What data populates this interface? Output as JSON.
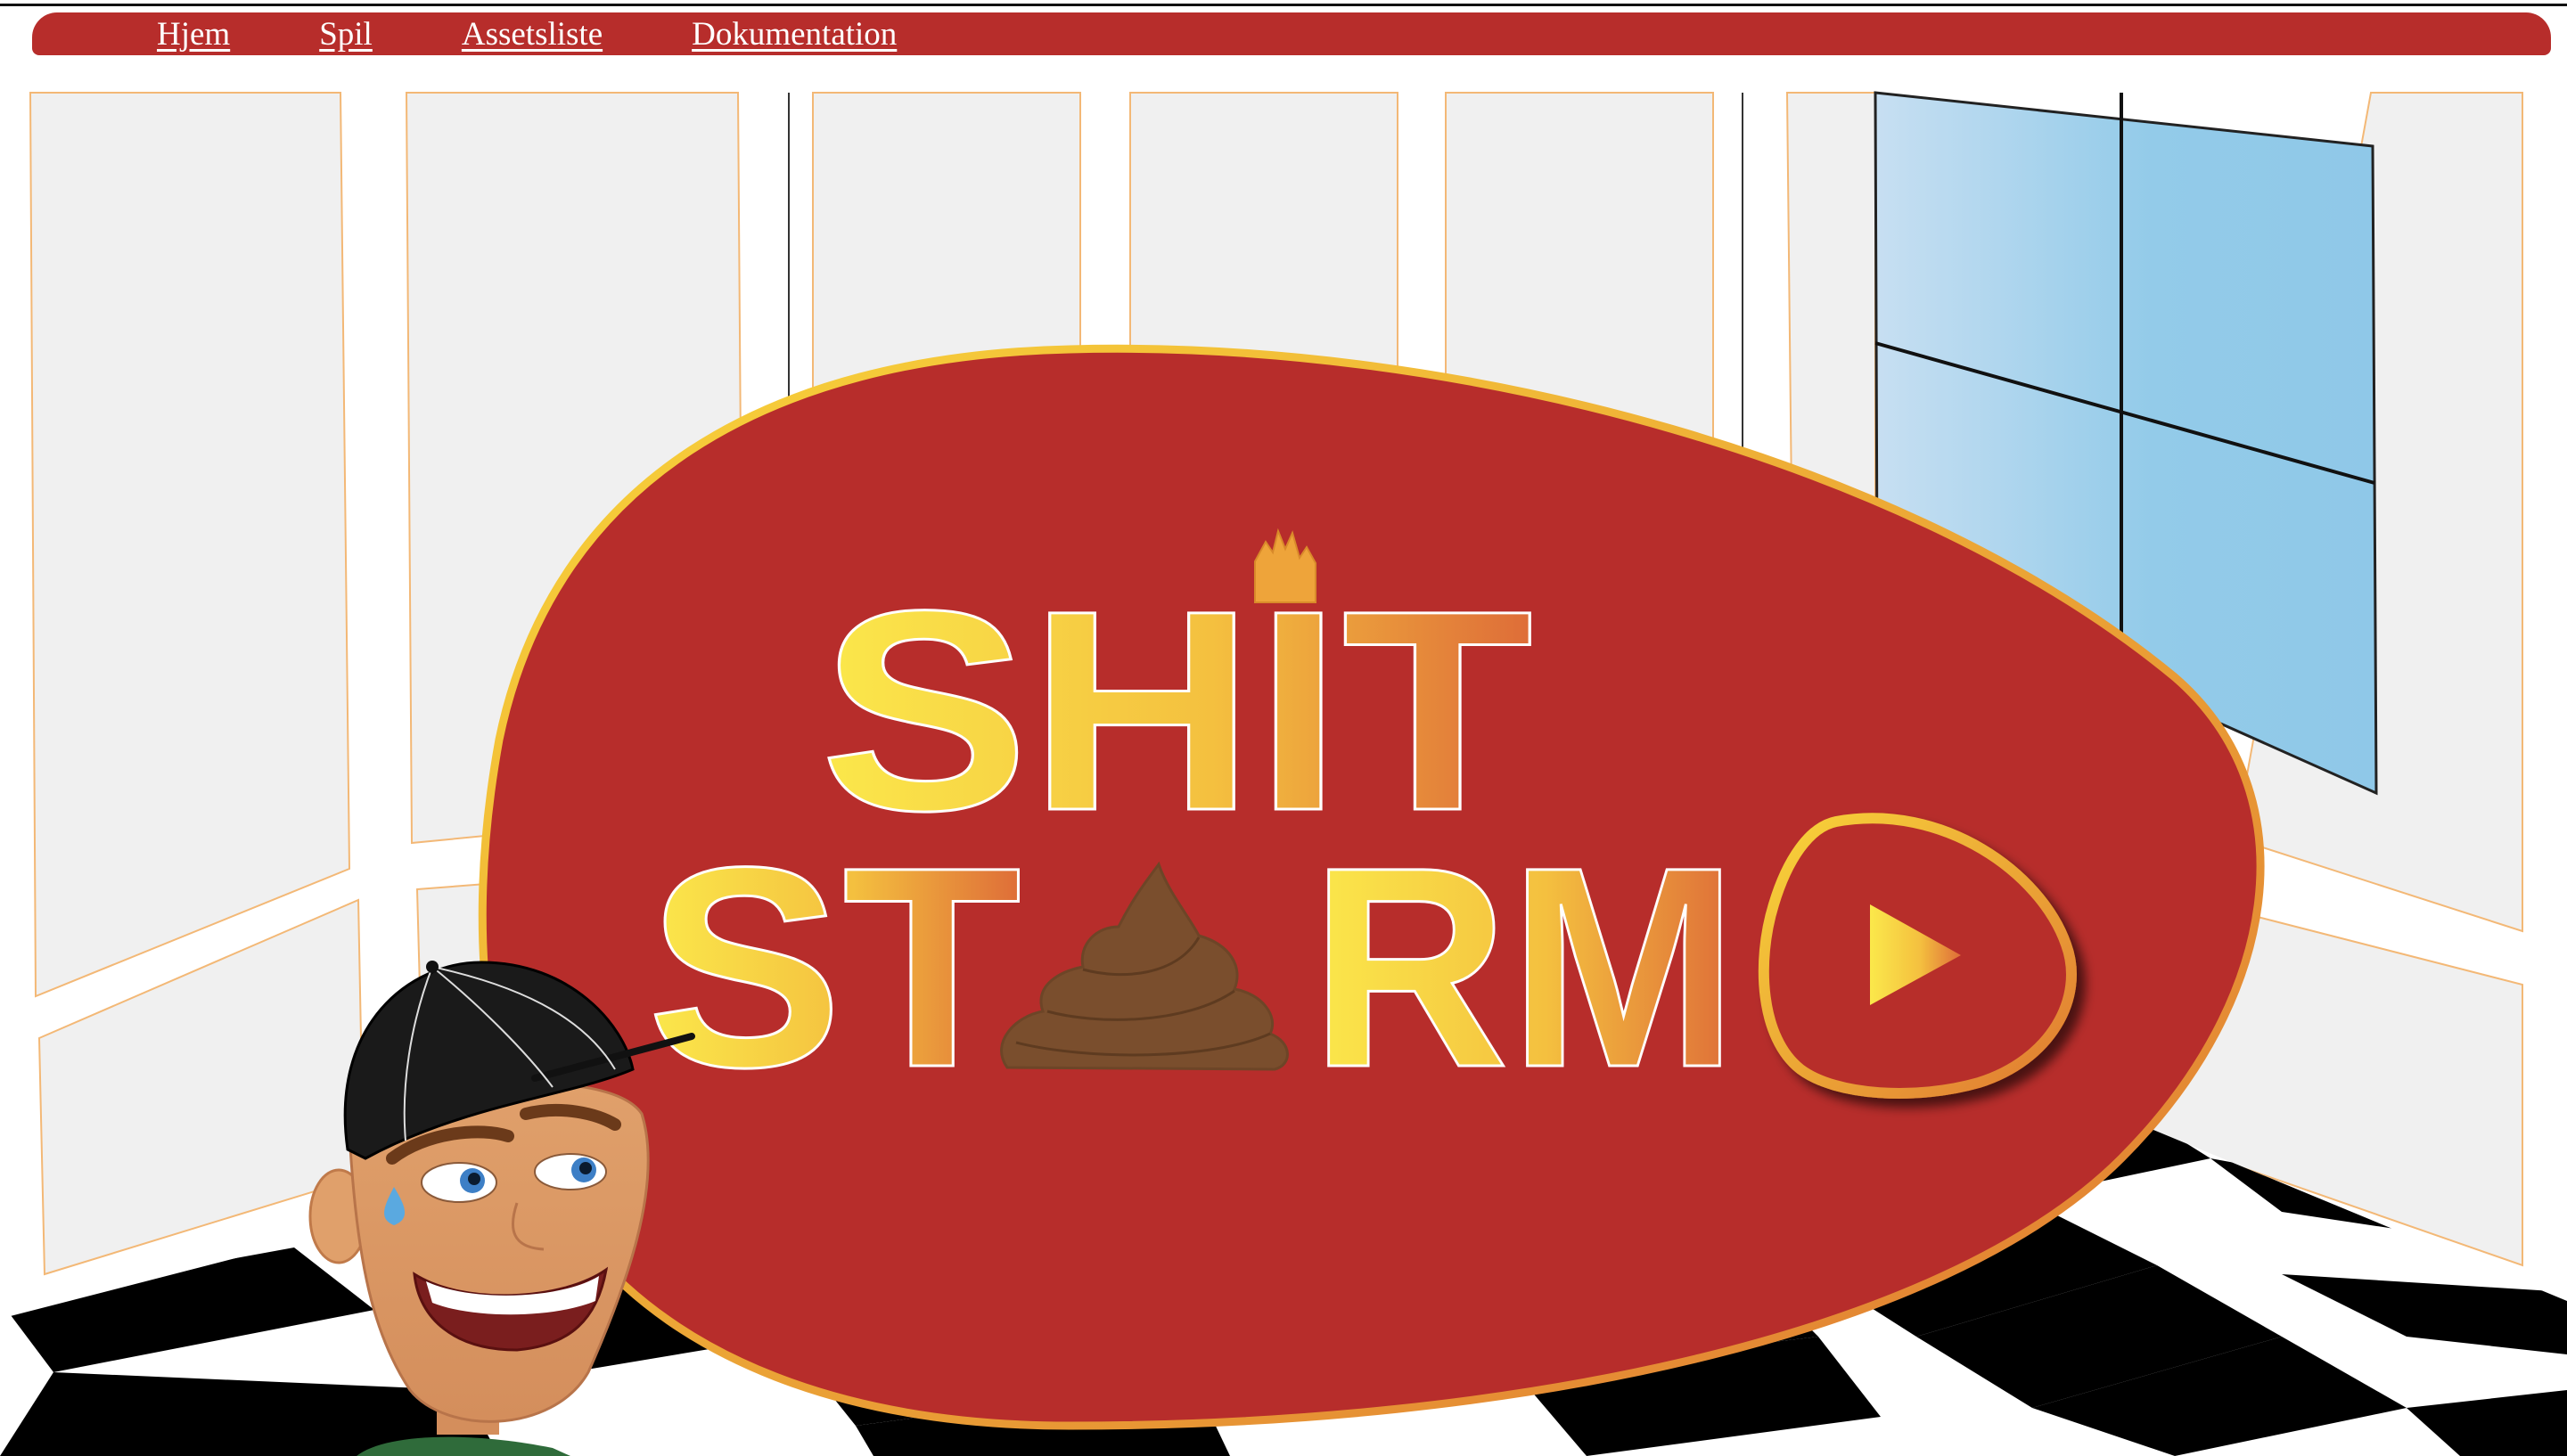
{
  "nav": {
    "items": [
      {
        "label": "Hjem"
      },
      {
        "label": "Spil"
      },
      {
        "label": "Assetsliste"
      },
      {
        "label": "Dokumentation"
      }
    ]
  },
  "logo": {
    "line1": "SHIT",
    "line2_left": "ST",
    "line2_right": "RM"
  },
  "colors": {
    "nav_bg": "#b72d2b",
    "blob_fill": "#b72d2b",
    "logo_gradient_start": "#fbe84b",
    "logo_gradient_end": "#de6c38",
    "poop": "#7a4e2d",
    "window_glass": "#93cbe9",
    "floor_dark": "#000000",
    "floor_light": "#ffffff"
  },
  "icons": {
    "play": "play-triangle-icon",
    "crown": "crown-icon",
    "poop": "poop-icon"
  }
}
